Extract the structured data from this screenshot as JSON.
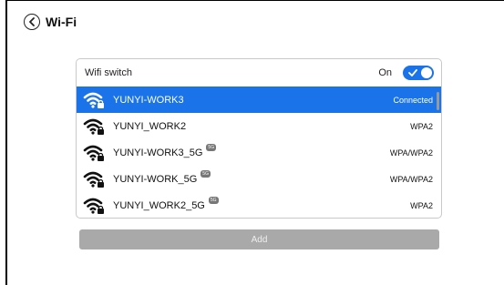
{
  "header": {
    "title": "Wi-Fi"
  },
  "wifi_switch": {
    "label": "Wifi switch",
    "state_label": "On",
    "enabled": true
  },
  "networks": [
    {
      "ssid": "YUNYI-WORK3",
      "security": "Connected",
      "badge": "",
      "selected": true
    },
    {
      "ssid": "YUNYI_WORK2",
      "security": "WPA2",
      "badge": "",
      "selected": false
    },
    {
      "ssid": "YUNYI-WORK3_5G",
      "security": "WPA/WPA2",
      "badge": "5G",
      "selected": false
    },
    {
      "ssid": "YUNYI-WORK_5G",
      "security": "WPA/WPA2",
      "badge": "5G",
      "selected": false
    },
    {
      "ssid": "YUNYI_WORK2_5G",
      "security": "WPA2",
      "badge": "5G",
      "selected": false
    }
  ],
  "add_button": {
    "label": "Add"
  },
  "colors": {
    "accent": "#1a73e8",
    "add_button_bg": "#a9a9a9"
  },
  "icons": {
    "back": "back-circle-icon",
    "wifi": "wifi-lock-icon",
    "check": "check-icon"
  }
}
